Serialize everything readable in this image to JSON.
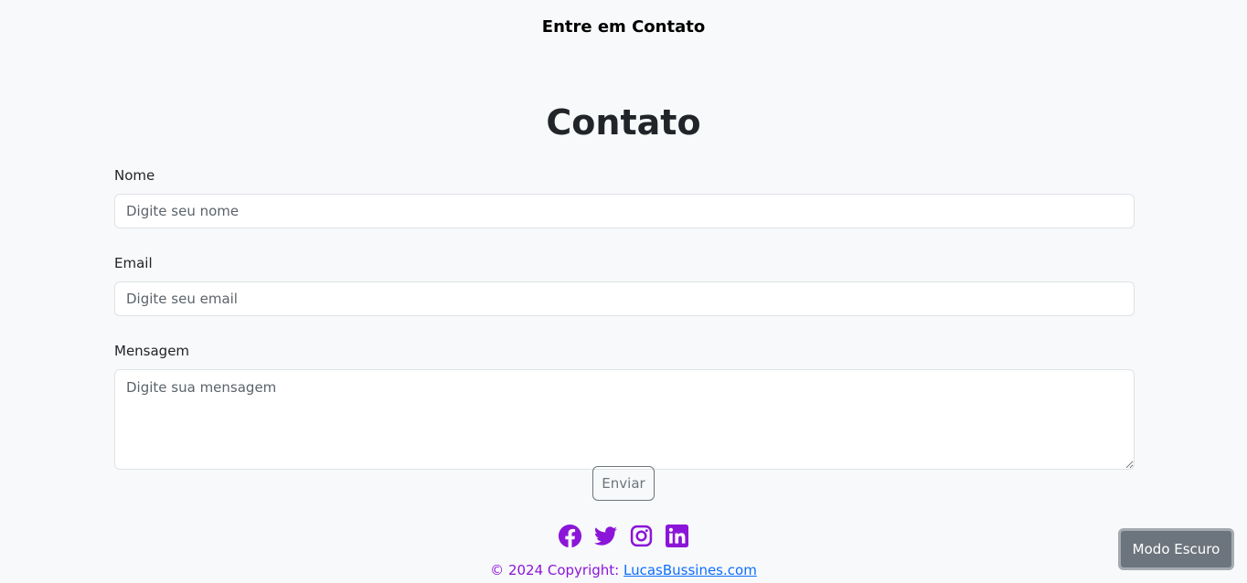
{
  "header": {
    "title": "Entre em Contato"
  },
  "main": {
    "heading": "Contato"
  },
  "form": {
    "name_label": "Nome",
    "name_placeholder": "Digite seu nome",
    "email_label": "Email",
    "email_placeholder": "Digite seu email",
    "message_label": "Mensagem",
    "message_placeholder": "Digite sua mensagem",
    "submit_label": "Enviar"
  },
  "social": {
    "icons": [
      "facebook-icon",
      "twitter-icon",
      "instagram-icon",
      "linkedin-icon"
    ],
    "icon_color": "#8b15d8"
  },
  "footer": {
    "copyright_prefix": "© 2024 Copyright: ",
    "link_text": "LucasBussines.com"
  },
  "theme_toggle": {
    "label": "Modo Escuro"
  }
}
